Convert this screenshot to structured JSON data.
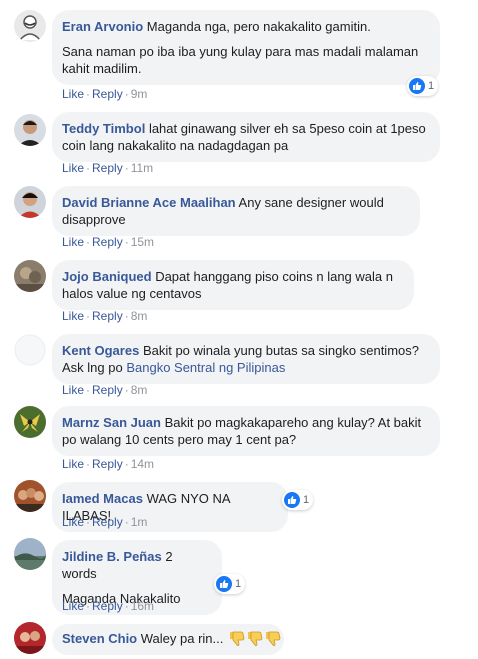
{
  "actions": {
    "like": "Like",
    "reply": "Reply",
    "separator": "·"
  },
  "comments": [
    {
      "author": "Eran Arvonio",
      "text": "Maganda nga, pero nakakalito gamitin.",
      "text2": "Sana naman po iba iba yung kulay para mas madali malaman kahit madilim.",
      "time": "9m",
      "likes": "1"
    },
    {
      "author": "Teddy Timbol",
      "text": "lahat ginawang silver eh sa 5peso coin at 1peso coin lang nakakalito na nadagdagan pa",
      "time": "11m"
    },
    {
      "author": "David Brianne Ace Maalihan",
      "text": "Any sane designer would disapprove",
      "time": "15m"
    },
    {
      "author": "Jojo Baniqued",
      "text": "Dapat hanggang piso coins n lang wala n halos value ng centavos",
      "time": "8m"
    },
    {
      "author": "Kent Ogares",
      "text": "Bakit po winala yung butas sa singko sentimos? Ask lng po",
      "link": "Bangko Sentral ng Pilipinas",
      "time": "8m"
    },
    {
      "author": "Marnz San Juan",
      "text": "Bakit po magkakapareho ang kulay? At bakit po walang 10 cents pero may 1 cent pa?",
      "time": "14m"
    },
    {
      "author": "Iamed Macas",
      "text": "WAG NYO NA ILABAS!",
      "time": "1m",
      "likes": "1"
    },
    {
      "author": "Jildine B. Peñas",
      "text": "2 words",
      "text2": "Maganda Nakakalito",
      "time": "16m",
      "likes": "1"
    },
    {
      "author": "Steven Chio",
      "text": "Waley pa rin...",
      "emoji": "thumbs-down-emoji"
    }
  ],
  "colors": {
    "author": "#385898",
    "bubble": "#f2f3f5",
    "like_badge": "#1877f2",
    "meta": "#90949c"
  }
}
